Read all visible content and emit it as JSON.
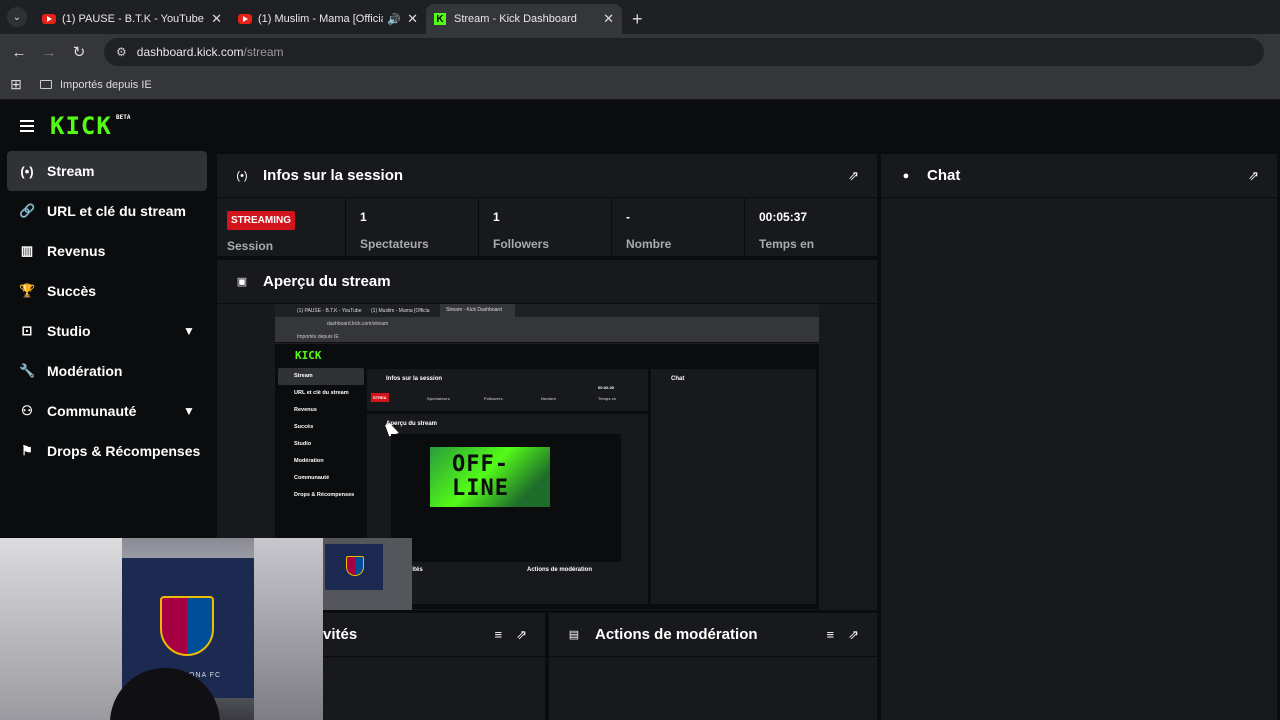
{
  "browser": {
    "tabs": [
      {
        "title": "(1) PAUSE - B.T.K - YouTube",
        "favicon": "youtube-icon"
      },
      {
        "title": "(1) Muslim - Mama [Official",
        "favicon": "youtube-icon",
        "audio": true
      },
      {
        "title": "Stream - Kick Dashboard",
        "favicon": "kick-icon",
        "active": true
      }
    ],
    "url_host": "dashboard.kick.com",
    "url_path": "/stream",
    "bookmark": "Importés depuis IE"
  },
  "app": {
    "logo": "KICK",
    "logo_badge": "BETA",
    "accent": "#53fc18"
  },
  "sidebar": {
    "items": [
      {
        "label": "Stream",
        "icon": "broadcast-icon",
        "active": true
      },
      {
        "label": "URL et clé du stream",
        "icon": "link-icon"
      },
      {
        "label": "Revenus",
        "icon": "chart-icon"
      },
      {
        "label": "Succès",
        "icon": "trophy-icon"
      },
      {
        "label": "Studio",
        "icon": "studio-icon",
        "expandable": true
      },
      {
        "label": "Modération",
        "icon": "wrench-icon"
      },
      {
        "label": "Communauté",
        "icon": "community-icon",
        "expandable": true
      },
      {
        "label": "Drops & Récompenses",
        "icon": "gift-icon"
      }
    ]
  },
  "session": {
    "title": "Infos sur la session",
    "badge": "STREAMING",
    "badge_color": "#d4141c",
    "stats": [
      {
        "value": "",
        "label": "Session"
      },
      {
        "value": "1",
        "label": "Spectateurs"
      },
      {
        "value": "1",
        "label": "Followers"
      },
      {
        "value": "-",
        "label": "Nombre"
      },
      {
        "value": "00:05:37",
        "label": "Temps en"
      }
    ]
  },
  "preview": {
    "title": "Aperçu du stream",
    "inner": {
      "tabs": [
        "(1) PAUSE - B.T.K - YouTube",
        "(1) Muslim - Mama [Officia",
        "Stream - Kick Dashboard"
      ],
      "url": "dashboard.kick.com/stream",
      "bookmark": "Importés depuis IE",
      "logo": "KICK",
      "nav": [
        "Stream",
        "URL et clé du stream",
        "Revenus",
        "Succès",
        "Studio",
        "Modération",
        "Communauté",
        "Drops & Récompenses"
      ],
      "session_title": "Infos sur la session",
      "badge": "STREA",
      "stats": [
        {
          "value": "",
          "label": "Session"
        },
        {
          "value": "1",
          "label": "Spectateurs"
        },
        {
          "value": "1",
          "label": "Followers"
        },
        {
          "value": "-",
          "label": "Nombre"
        },
        {
          "value": "00:02:20",
          "label": "Temps en"
        }
      ],
      "preview_title": "Aperçu du stream",
      "chat_title": "Chat",
      "offline_text": "OFF-\nLINE",
      "activities_title": "vités",
      "moderation_title": "Actions de modération"
    }
  },
  "chat": {
    "title": "Chat"
  },
  "activities": {
    "title": "vités"
  },
  "moderation": {
    "title": "Actions de modération"
  },
  "webcam": {
    "caption": "BARCELONA FC"
  }
}
